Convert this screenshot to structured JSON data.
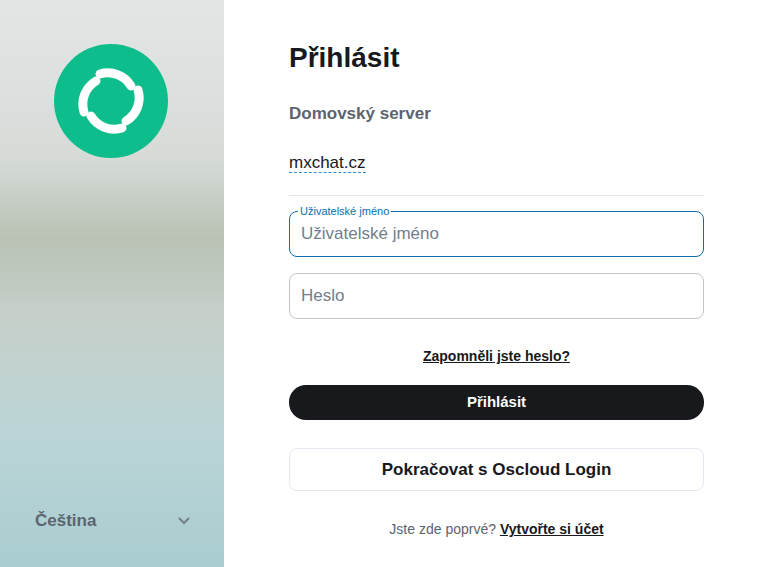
{
  "language_selector": {
    "label": "Čeština"
  },
  "title": "Přihlásit",
  "homeserver": {
    "label": "Domovský server",
    "value": "mxchat.cz"
  },
  "fields": [
    {
      "label": "Uživatelské jméno",
      "placeholder": "Uživatelské jméno",
      "focused": true
    },
    {
      "placeholder": "Heslo",
      "focused": false
    }
  ],
  "forgot_link": "Zapomněli jste heslo?",
  "buttons": [
    {
      "label": "Přihlásit",
      "kind": "primary"
    },
    {
      "label": "Pokračovat s Oscloud Login",
      "kind": "outline"
    }
  ],
  "footer": {
    "text": "Jste zde poprvé?",
    "link": "Vytvořte si účet"
  }
}
